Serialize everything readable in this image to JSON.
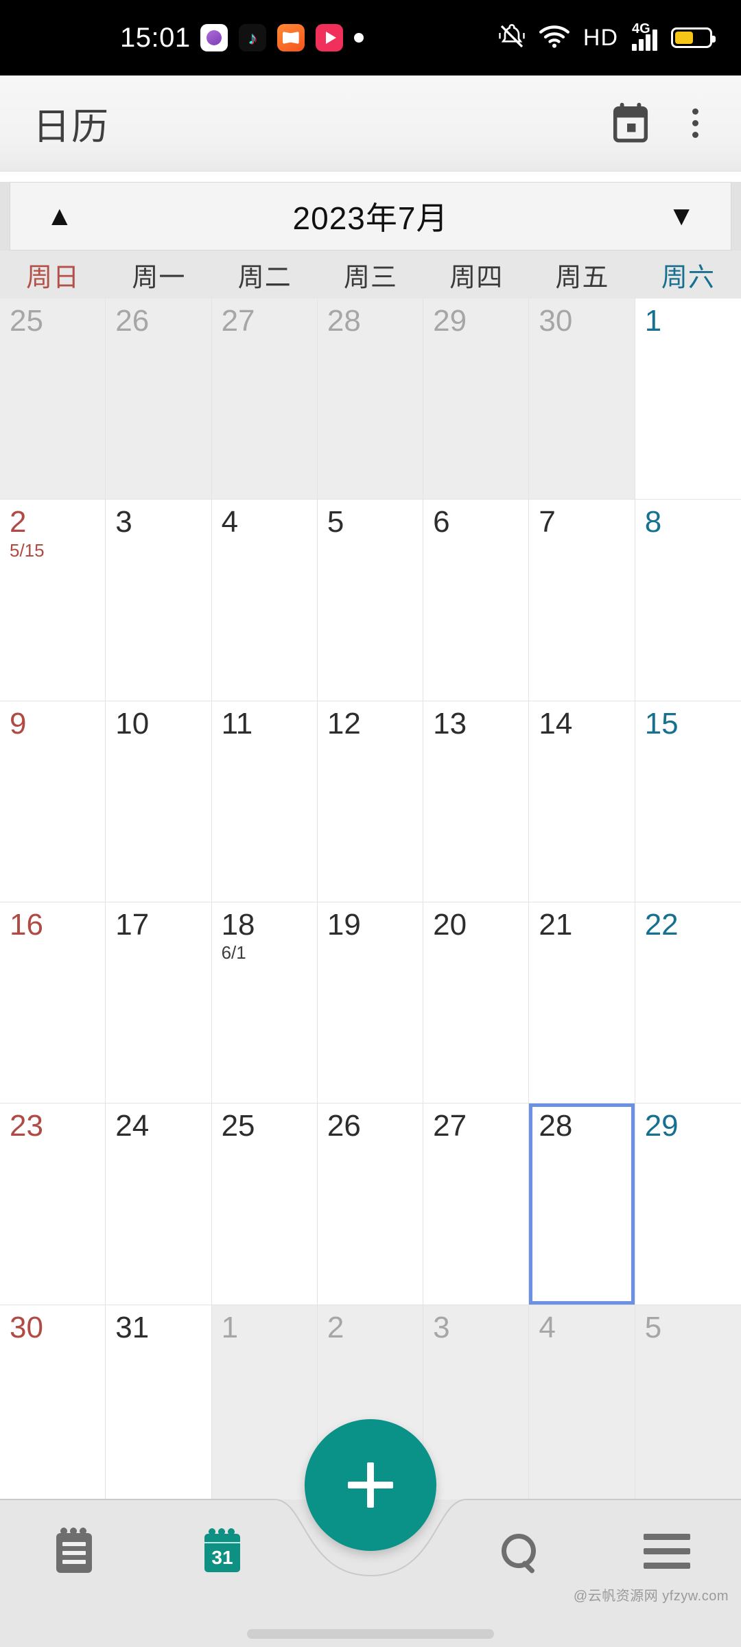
{
  "statusbar": {
    "time": "15:01",
    "notification_icons": [
      "instagram-icon",
      "tiktok-icon",
      "book-app-icon",
      "video-app-icon",
      "dot-icon"
    ],
    "system_icons": [
      "silent-vibrate-icon",
      "wifi-icon",
      "hd-icon",
      "signal-4g-icon",
      "battery-icon"
    ],
    "hd_label": "HD",
    "network_label": "4G",
    "battery_color": "#f5c518"
  },
  "appbar": {
    "title": "日历",
    "today_icon": "calendar-today-icon",
    "overflow_icon": "overflow-menu-icon"
  },
  "monthnav": {
    "prev_icon": "▲",
    "label": "2023年7月",
    "next_icon": "▼"
  },
  "weekdays": [
    {
      "label": "周日",
      "type": "sun"
    },
    {
      "label": "周一",
      "type": "wd"
    },
    {
      "label": "周二",
      "type": "wd"
    },
    {
      "label": "周三",
      "type": "wd"
    },
    {
      "label": "周四",
      "type": "wd"
    },
    {
      "label": "周五",
      "type": "wd"
    },
    {
      "label": "周六",
      "type": "sat"
    }
  ],
  "colors": {
    "sunday": "#b04a42",
    "saturday": "#16708f",
    "weekday": "#2d2d2d",
    "other_month": "#a6a6a6",
    "selection_border": "#6d8fe4",
    "accent": "#0a9288"
  },
  "calendar": {
    "rows": [
      [
        {
          "day": "25",
          "other": true,
          "col": "sun"
        },
        {
          "day": "26",
          "other": true,
          "col": "wd"
        },
        {
          "day": "27",
          "other": true,
          "col": "wd"
        },
        {
          "day": "28",
          "other": true,
          "col": "wd"
        },
        {
          "day": "29",
          "other": true,
          "col": "wd"
        },
        {
          "day": "30",
          "other": true,
          "col": "wd"
        },
        {
          "day": "1",
          "other": false,
          "col": "sat"
        }
      ],
      [
        {
          "day": "2",
          "other": false,
          "col": "sun",
          "sub": "5/15"
        },
        {
          "day": "3",
          "other": false,
          "col": "wd"
        },
        {
          "day": "4",
          "other": false,
          "col": "wd"
        },
        {
          "day": "5",
          "other": false,
          "col": "wd"
        },
        {
          "day": "6",
          "other": false,
          "col": "wd"
        },
        {
          "day": "7",
          "other": false,
          "col": "wd"
        },
        {
          "day": "8",
          "other": false,
          "col": "sat"
        }
      ],
      [
        {
          "day": "9",
          "other": false,
          "col": "sun"
        },
        {
          "day": "10",
          "other": false,
          "col": "wd"
        },
        {
          "day": "11",
          "other": false,
          "col": "wd"
        },
        {
          "day": "12",
          "other": false,
          "col": "wd"
        },
        {
          "day": "13",
          "other": false,
          "col": "wd"
        },
        {
          "day": "14",
          "other": false,
          "col": "wd"
        },
        {
          "day": "15",
          "other": false,
          "col": "sat"
        }
      ],
      [
        {
          "day": "16",
          "other": false,
          "col": "sun"
        },
        {
          "day": "17",
          "other": false,
          "col": "wd"
        },
        {
          "day": "18",
          "other": false,
          "col": "wd",
          "sub": "6/1"
        },
        {
          "day": "19",
          "other": false,
          "col": "wd"
        },
        {
          "day": "20",
          "other": false,
          "col": "wd"
        },
        {
          "day": "21",
          "other": false,
          "col": "wd"
        },
        {
          "day": "22",
          "other": false,
          "col": "sat"
        }
      ],
      [
        {
          "day": "23",
          "other": false,
          "col": "sun"
        },
        {
          "day": "24",
          "other": false,
          "col": "wd"
        },
        {
          "day": "25",
          "other": false,
          "col": "wd"
        },
        {
          "day": "26",
          "other": false,
          "col": "wd"
        },
        {
          "day": "27",
          "other": false,
          "col": "wd"
        },
        {
          "day": "28",
          "other": false,
          "col": "wd",
          "selected": true
        },
        {
          "day": "29",
          "other": false,
          "col": "sat"
        }
      ],
      [
        {
          "day": "30",
          "other": false,
          "col": "sun"
        },
        {
          "day": "31",
          "other": false,
          "col": "wd"
        },
        {
          "day": "1",
          "other": true,
          "col": "wd"
        },
        {
          "day": "2",
          "other": true,
          "col": "wd"
        },
        {
          "day": "3",
          "other": true,
          "col": "wd"
        },
        {
          "day": "4",
          "other": true,
          "col": "wd"
        },
        {
          "day": "5",
          "other": true,
          "col": "sat"
        }
      ]
    ]
  },
  "bottomnav": {
    "items": [
      {
        "name": "agenda-view-icon",
        "active": false
      },
      {
        "name": "month-view-icon",
        "active": true,
        "badge": "31"
      },
      {
        "name": "search-icon",
        "active": false
      },
      {
        "name": "menu-icon",
        "active": false
      }
    ],
    "fab_icon": "add-event-icon"
  },
  "watermark": "@云帆资源网 yfzyw.com"
}
